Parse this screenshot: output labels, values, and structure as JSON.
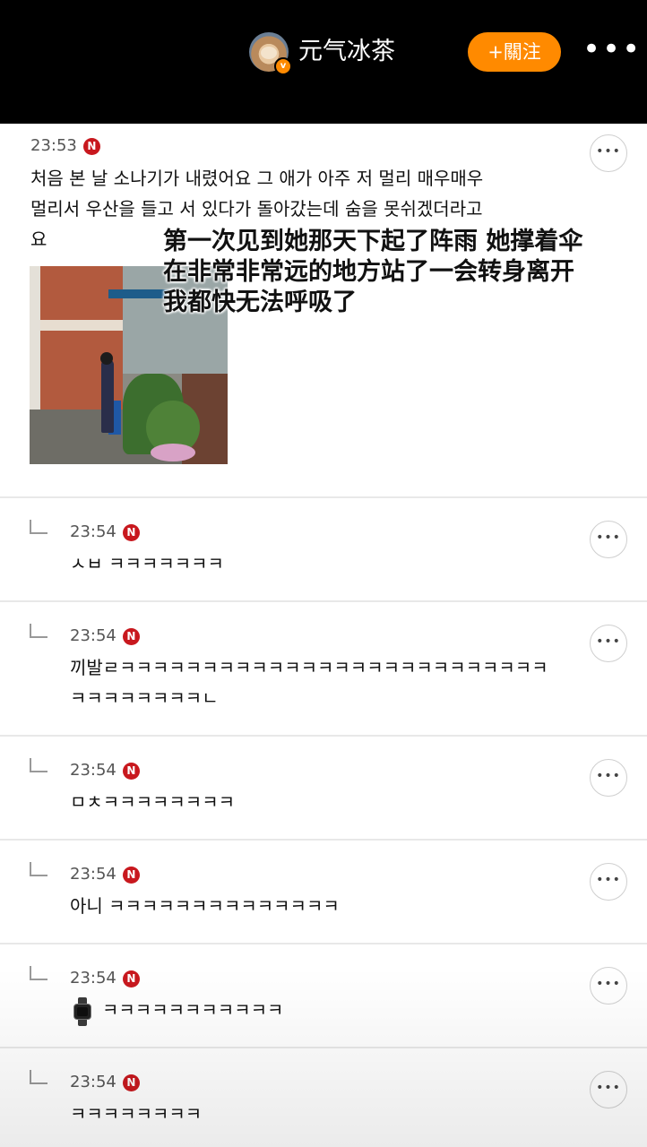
{
  "header": {
    "username": "元气冰茶",
    "follow_label": "+關注",
    "more_icon": "more-horizontal-icon",
    "verified_icon": "verified-badge-icon"
  },
  "post": {
    "timestamp": "23:53",
    "badge": "N",
    "text": "처음 본 날 소나기가 내렸어요 그 애가 아주 저 멀리 매우매우\n멀리서 우산을 들고 서 있다가 돌아갔는데 숨을 못쉬겠더라고\n요",
    "overlay_lines": [
      "第一次见到她那天下起了阵雨 她撑着伞",
      "在非常非常远的地方站了一会转身离开",
      "我都快无法呼吸了"
    ]
  },
  "replies": [
    {
      "timestamp": "23:54",
      "badge": "N",
      "text": "ㅅㅂ ㅋㅋㅋㅋㅋㅋㅋ"
    },
    {
      "timestamp": "23:54",
      "badge": "N",
      "text": "끼발ㄹㅋㅋㅋㅋㅋㅋㅋㅋㅋㅋㅋㅋㅋㅋㅋㅋㅋㅋㅋㅋㅋㅋㅋㅋㅋㅋ\nㅋㅋㅋㅋㅋㅋㅋㅋㄴ"
    },
    {
      "timestamp": "23:54",
      "badge": "N",
      "text": "ㅁㅊㅋㅋㅋㅋㅋㅋㅋㅋ"
    },
    {
      "timestamp": "23:54",
      "badge": "N",
      "text": "아니 ㅋㅋㅋㅋㅋㅋㅋㅋㅋㅋㅋㅋㅋㅋ"
    },
    {
      "timestamp": "23:54",
      "badge": "N",
      "icon": "watch-emoji-icon",
      "text": "ㅋㅋㅋㅋㅋㅋㅋㅋㅋㅋㅋ"
    },
    {
      "timestamp": "23:54",
      "badge": "N",
      "text": "ㅋㅋㅋㅋㅋㅋㅋㅋ"
    }
  ],
  "colors": {
    "topbar": "#000000",
    "follow_button": "#ff8a00",
    "n_badge": "#c8181e"
  }
}
